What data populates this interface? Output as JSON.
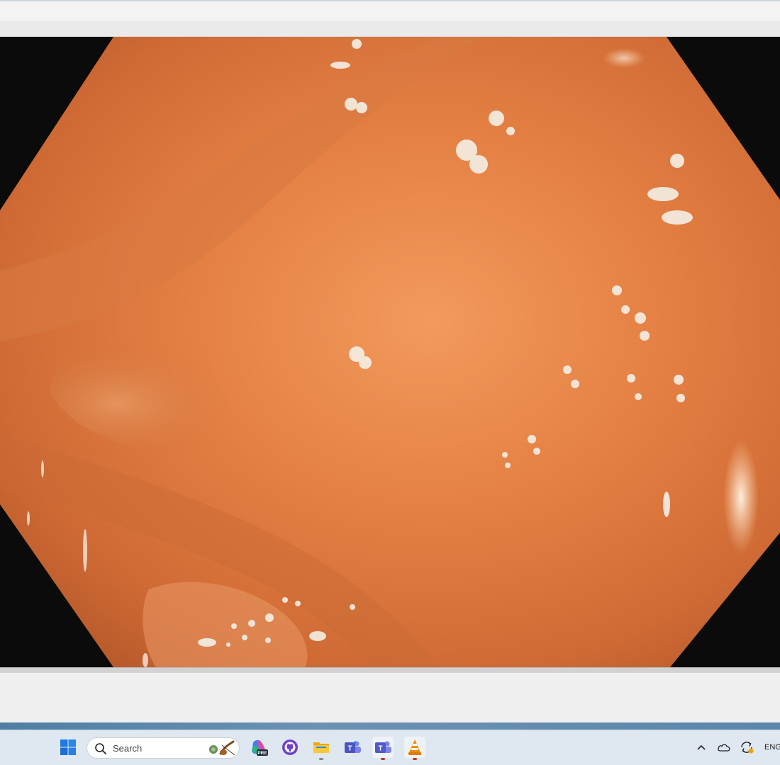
{
  "window": {
    "video_description_colors": {
      "tissue_base": "#e07a3d",
      "tissue_light": "#f29a5c",
      "tissue_dark": "#b5572a",
      "vignette": "#0b0b0b"
    }
  },
  "taskbar": {
    "search_placeholder": "Search",
    "language": "ENG",
    "apps": [
      {
        "icon": "windows-start-icon"
      },
      {
        "icon": "copilot-pre-icon"
      },
      {
        "icon": "github-icon"
      },
      {
        "icon": "file-explorer-icon"
      },
      {
        "icon": "teams-classic-icon"
      },
      {
        "icon": "teams-icon"
      },
      {
        "icon": "vlc-icon"
      }
    ],
    "tray": [
      {
        "icon": "chevron-up-icon"
      },
      {
        "icon": "onedrive-cloud-icon"
      },
      {
        "icon": "sync-icon"
      }
    ]
  }
}
